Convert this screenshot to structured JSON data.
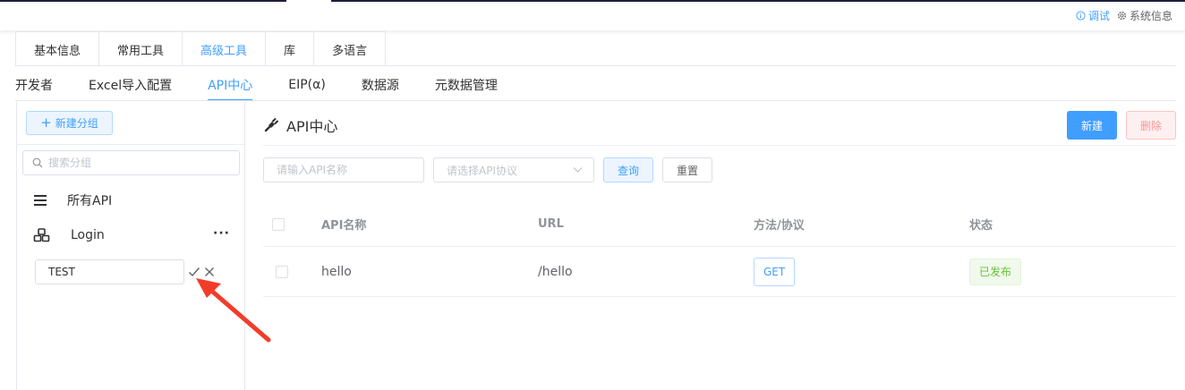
{
  "topbar": {
    "debug_label": "调试",
    "system_label": "系统信息"
  },
  "outer_tabs": [
    "基本信息",
    "常用工具",
    "高级工具",
    "库",
    "多语言"
  ],
  "outer_active": "高级工具",
  "inner_tabs": [
    "开发者",
    "Excel导入配置",
    "API中心",
    "EIP(α)",
    "数据源",
    "元数据管理"
  ],
  "inner_active": "API中心",
  "sidebar": {
    "new_group_label": "新建分组",
    "search_placeholder": "搜索分组",
    "items": [
      {
        "label": "所有API",
        "icon": "list-icon"
      },
      {
        "label": "Login",
        "icon": "cubes-icon",
        "more": "···"
      }
    ],
    "edit_value": "TEST"
  },
  "main": {
    "title": "API中心",
    "new_label": "新建",
    "delete_label": "删除",
    "name_placeholder": "请输入API名称",
    "protocol_placeholder": "请选择API协议",
    "query_label": "查询",
    "reset_label": "重置"
  },
  "table": {
    "columns": [
      "API名称",
      "URL",
      "方法/协议",
      "状态"
    ],
    "rows": [
      {
        "name": "hello",
        "url": "/hello",
        "method": "GET",
        "status": "已发布"
      }
    ]
  },
  "colors": {
    "primary": "#409eff",
    "danger_light": "#f89898",
    "success": "#67c23a",
    "annotation_arrow": "#f23c2a"
  }
}
